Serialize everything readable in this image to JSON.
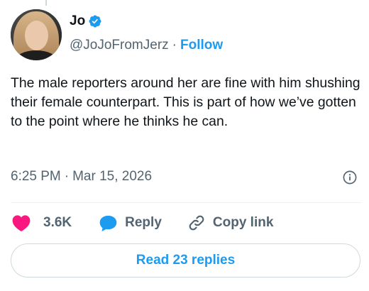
{
  "author": {
    "display_name": "Jo",
    "handle": "@JoJoFromJerz",
    "verified_icon": "verified-badge-icon",
    "follow_label": "Follow",
    "separator": "·"
  },
  "tweet": {
    "text": "The male reporters around her are fine with him shushing their female counterpart. This is part of how we’ve gotten to the point where he thinks he can.",
    "time": "6:25 PM",
    "separator": "·",
    "date": "Mar 15, 2026"
  },
  "actions": {
    "like_count": "3.6K",
    "reply_label": "Reply",
    "copy_link_label": "Copy link"
  },
  "replies": {
    "read_label": "Read 23 replies"
  },
  "icons": {
    "info": "info-icon",
    "like": "heart-icon",
    "reply": "speech-bubble-icon",
    "copy_link": "link-icon"
  },
  "colors": {
    "accent": "#1d9bf0",
    "like": "#f91880",
    "secondary_text": "#536471",
    "text": "#0f1419"
  }
}
